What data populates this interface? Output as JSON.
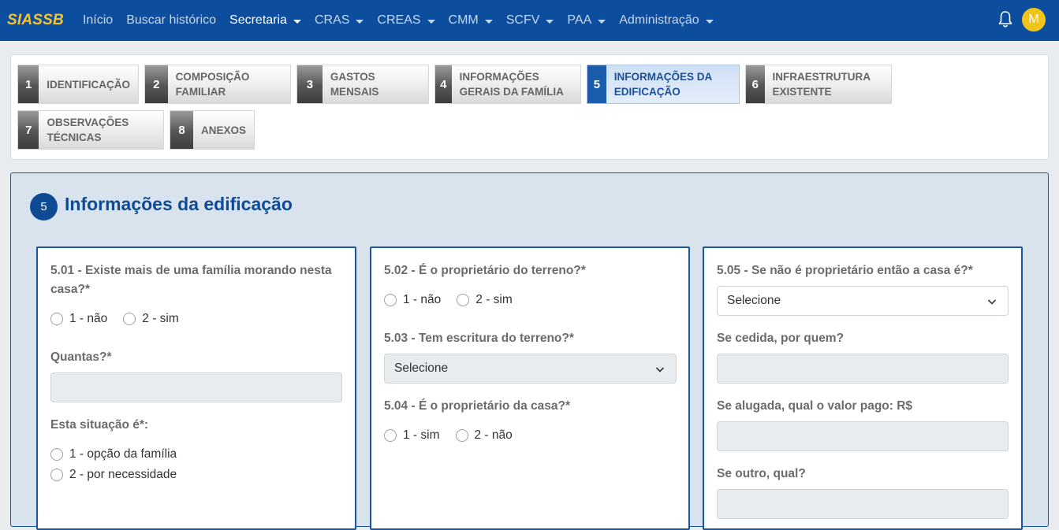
{
  "navbar": {
    "brand": "SIASSB",
    "items": [
      {
        "label": "Início",
        "dropdown": false,
        "active": false
      },
      {
        "label": "Buscar histórico",
        "dropdown": false,
        "active": false
      },
      {
        "label": "Secretaria",
        "dropdown": true,
        "active": true
      },
      {
        "label": "CRAS",
        "dropdown": true,
        "active": false
      },
      {
        "label": "CREAS",
        "dropdown": true,
        "active": false
      },
      {
        "label": "CMM",
        "dropdown": true,
        "active": false
      },
      {
        "label": "SCFV",
        "dropdown": true,
        "active": false
      },
      {
        "label": "PAA",
        "dropdown": true,
        "active": false
      },
      {
        "label": "Administração",
        "dropdown": true,
        "active": false
      }
    ],
    "bell_icon": "bell-icon",
    "avatar_initial": "M"
  },
  "steps": [
    {
      "num": "1",
      "label": "Identificação"
    },
    {
      "num": "2",
      "label": "Composição Familiar"
    },
    {
      "num": "3",
      "label": "Gastos Mensais"
    },
    {
      "num": "4",
      "label": "Informações Gerais da Família"
    },
    {
      "num": "5",
      "label": "Informações da Edificação",
      "active": true
    },
    {
      "num": "6",
      "label": "Infraestrutura Existente"
    },
    {
      "num": "7",
      "label": "Observações Técnicas"
    },
    {
      "num": "8",
      "label": "Anexos"
    }
  ],
  "section": {
    "badge": "5",
    "title": "Informações da edificação"
  },
  "col1": {
    "q501": "5.01 - Existe mais de uma família morando nesta casa?*",
    "q501_opt1": "1 - não",
    "q501_opt2": "2 - sim",
    "quantas": "Quantas?*",
    "situacao": "Esta situação é*:",
    "situacao_opt1": "1 - opção da família",
    "situacao_opt2": "2 - por necessidade"
  },
  "col2": {
    "q502": "5.02 - É o proprietário do terreno?*",
    "q502_opt1": "1 - não",
    "q502_opt2": "2 - sim",
    "q503": "5.03 - Tem escritura do terreno?*",
    "q503_select": "Selecione",
    "q504": "5.04 - É o proprietário da casa?*",
    "q504_opt1": "1 - sim",
    "q504_opt2": "2 - não"
  },
  "col3": {
    "q505": "5.05 - Se não é proprietário então a casa é?*",
    "q505_select": "Selecione",
    "cedida": "Se cedida, por quem?",
    "alugada": "Se alugada, qual o valor pago: R$",
    "outro": "Se outro, qual?"
  },
  "colors": {
    "navbar": "#0d4d9e",
    "brand": "#f4c430",
    "accent": "#0f4b93",
    "section_bg": "#d9e3ee",
    "avatar": "#f0c419"
  }
}
